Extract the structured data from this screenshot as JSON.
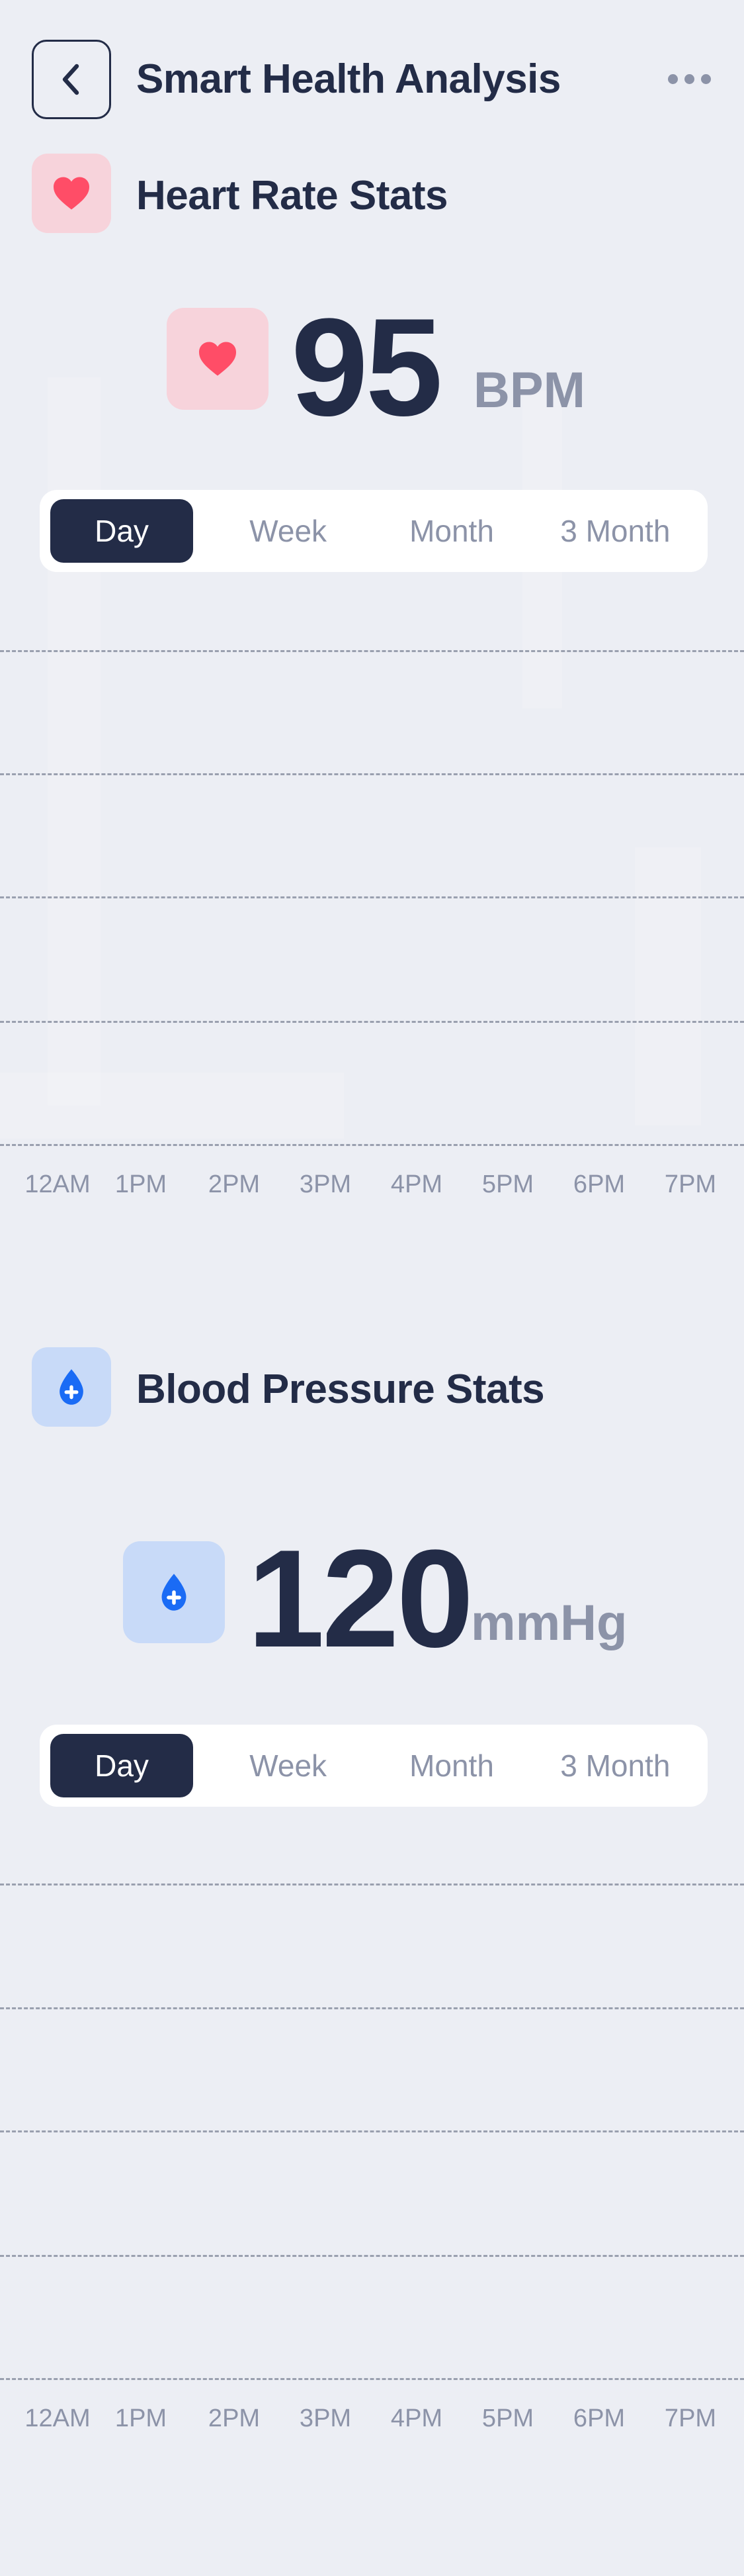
{
  "header": {
    "title": "Smart Health Analysis",
    "back_icon": "chevron-left-icon",
    "more_icon": "more-horizontal-icon"
  },
  "heart_rate": {
    "section_title": "Heart Rate Stats",
    "icon": "heart-icon",
    "accent_color": "#FF4D67",
    "icon_bg": "#F7D3DB",
    "value": "95",
    "unit": "BPM",
    "tabs": [
      {
        "label": "Day",
        "selected": true
      },
      {
        "label": "Week",
        "selected": false
      },
      {
        "label": "Month",
        "selected": false
      },
      {
        "label": "3 Month",
        "selected": false
      }
    ],
    "x_axis": [
      "12AM",
      "1PM",
      "2PM",
      "3PM",
      "4PM",
      "5PM",
      "6PM",
      "7PM"
    ]
  },
  "blood_pressure": {
    "section_title": "Blood Pressure Stats",
    "icon": "blood-drop-plus-icon",
    "accent_color": "#1A6BF5",
    "icon_bg": "#C8DAF8",
    "value": "120",
    "unit": "mmHg",
    "tabs": [
      {
        "label": "Day",
        "selected": true
      },
      {
        "label": "Week",
        "selected": false
      },
      {
        "label": "Month",
        "selected": false
      },
      {
        "label": "3 Month",
        "selected": false
      }
    ],
    "x_axis": [
      "12AM",
      "1PM",
      "2PM",
      "3PM",
      "4PM",
      "5PM",
      "6PM",
      "7PM"
    ]
  },
  "colors": {
    "background": "#ECEEF4",
    "primary": "#232C47",
    "muted": "#8C93A8",
    "card": "#FFFFFF"
  }
}
